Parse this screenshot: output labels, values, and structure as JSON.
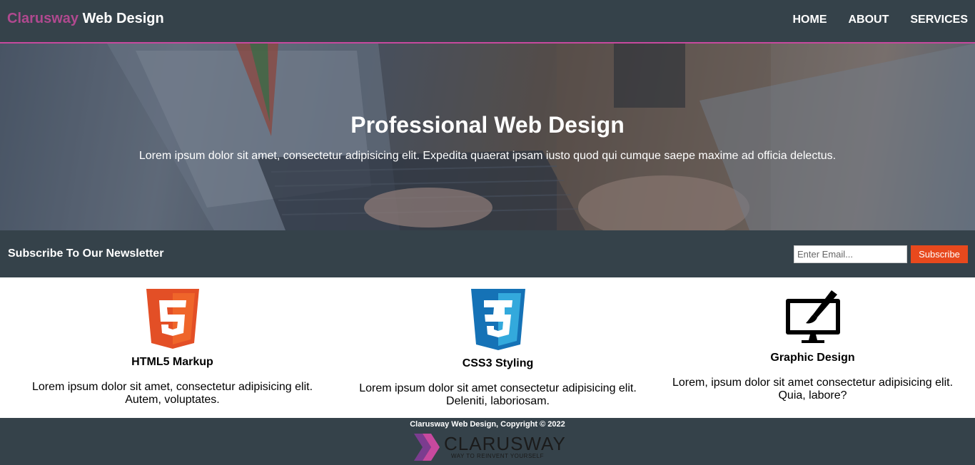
{
  "header": {
    "brand_accent": "Clarusway",
    "brand_rest": " Web Design",
    "nav": [
      {
        "label": "HOME"
      },
      {
        "label": "ABOUT"
      },
      {
        "label": "SERVICES"
      }
    ]
  },
  "hero": {
    "title": "Professional Web Design",
    "text": "Lorem ipsum dolor sit amet, consectetur adipisicing elit. Expedita quaerat ipsam iusto quod qui cumque saepe maxime ad officia delectus."
  },
  "newsletter": {
    "heading": "Subscribe To Our Newsletter",
    "email_placeholder": "Enter Email...",
    "button_label": "Subscribe"
  },
  "boxes": [
    {
      "icon": "html5-icon",
      "title": "HTML5 Markup",
      "text": "Lorem ipsum dolor sit amet, consectetur adipisicing elit. Autem, voluptates."
    },
    {
      "icon": "css3-icon",
      "title": "CSS3 Styling",
      "text": "Lorem ipsum dolor sit amet consectetur adipisicing elit. Deleniti, laboriosam."
    },
    {
      "icon": "graphic-design-icon",
      "title": "Graphic Design",
      "text": "Lorem, ipsum dolor sit amet consectetur adipisicing elit. Quia, labore?"
    }
  ],
  "footer": {
    "copyright": "Clarusway Web Design, Copyright © 2022",
    "logo_name": "CLARUSWAY",
    "logo_tagline": "WAY TO REINVENT YOURSELF"
  },
  "colors": {
    "dark": "#35424a",
    "accent": "#b0498f",
    "button": "#e8491d"
  }
}
